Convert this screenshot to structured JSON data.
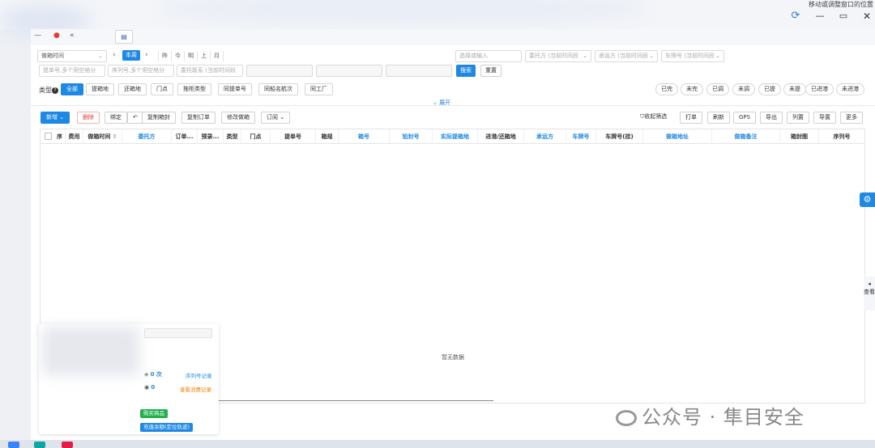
{
  "window": {
    "title": "移动或调整窗口的位置",
    "refresh_icon": "refresh-icon",
    "minimize_icon": "minimize-icon",
    "maximize_icon": "maximize-icon",
    "close_icon": "close-icon"
  },
  "filters": {
    "date_field": "做箱时间",
    "week_button": "本周",
    "days": [
      "昨",
      "今",
      "明",
      "上",
      "月"
    ],
    "search_placeholder_1": "提单号,多个用空格分",
    "search_placeholder_2": "序列号,多个用空格分",
    "search_placeholder_3": "委托联系 (当前时间段",
    "placeholder_select": "选择或输入",
    "client_select": "委托方 (当前时间段",
    "carrier_select": "承运方 (当前时间段",
    "plate_select": "车牌号 (当前时间段",
    "search_button": "搜索",
    "reset_button": "重置"
  },
  "types": {
    "label": "类型",
    "items": [
      "全部",
      "提箱地",
      "还箱地",
      "门点",
      "拖柜类型",
      "同提单号",
      "同船名航次",
      "同工厂"
    ],
    "active": "全部",
    "status_items": [
      "已完",
      "未完",
      "已调",
      "未调",
      "已提",
      "未提",
      "已进港",
      "未进港"
    ],
    "expand_label": "展开"
  },
  "actions": {
    "left": [
      "新增",
      "删除",
      "绑定",
      "复制箱封",
      "复制订单",
      "修改做箱",
      "订阅"
    ],
    "right": [
      "收起筛选",
      "打单",
      "刷新",
      "GPS",
      "导出",
      "列置",
      "导置",
      "更多"
    ]
  },
  "table": {
    "columns": [
      "序",
      "费用",
      "做箱时间",
      "委托方",
      "订单...",
      "预录...",
      "类型",
      "门点",
      "提单号",
      "箱规",
      "箱号",
      "铅封号",
      "实际提箱地",
      "进港/还箱地",
      "承运方",
      "车牌号",
      "车牌号(挂)",
      "做箱地址",
      "做箱备注",
      "箱封图",
      "序列号"
    ],
    "blue_columns": [
      "委托方",
      "箱号",
      "铅封号",
      "实际提箱地",
      "承运方",
      "车牌号",
      "做箱地址",
      "做箱备注"
    ],
    "empty_text": "暂无数据"
  },
  "popup": {
    "serial_count": "0 次",
    "serial_link": "序列号记录",
    "sms_count": "0",
    "sms_link": "查看消费记录",
    "buy_button": "购买商品",
    "recharge_button": "充值余额(定位轨迹)"
  },
  "side": {
    "gear_icon": "gear-icon",
    "tab_label": "查看"
  },
  "watermark": {
    "text": "公众号 · 隼目安全",
    "icon": "wechat-icon"
  },
  "colors": {
    "primary": "#1e88e5",
    "danger": "#e53935",
    "link_orange": "#f57c00",
    "green": "#22b14c"
  }
}
